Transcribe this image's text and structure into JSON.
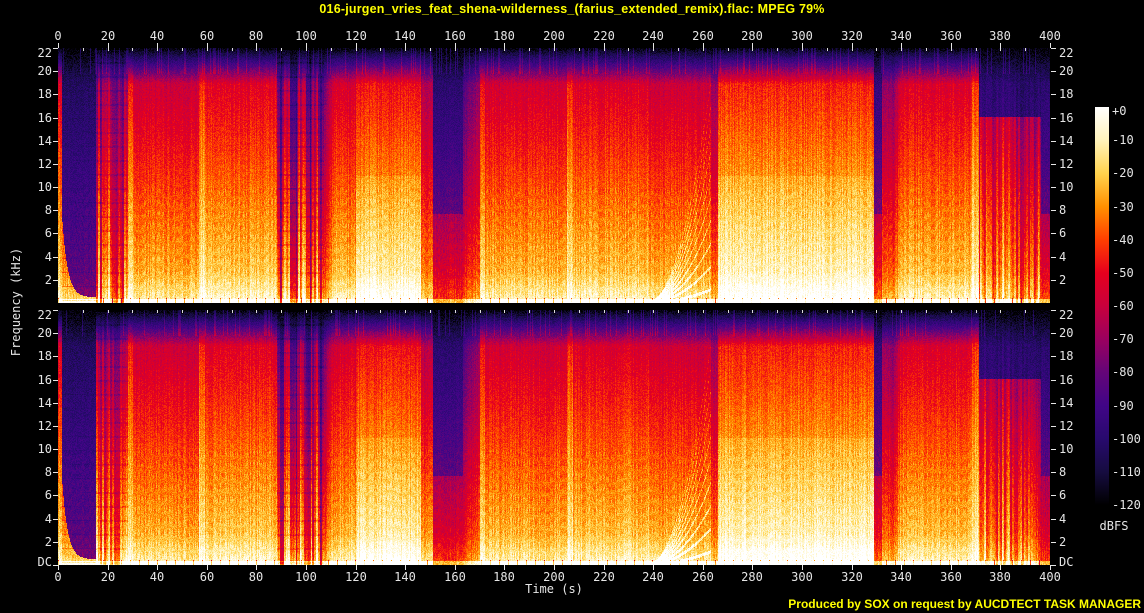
{
  "title": "016-jurgen_vries_feat_shena-wilderness_(farius_extended_remix).flac: MPEG 79%",
  "credit": "Produced by SOX on request by AUCDTECT TASK MANAGER",
  "colors": {
    "background": "#000000",
    "title_text": "#ffff00",
    "credit_text": "#ffff00",
    "axis_text": "#e6e6e6"
  },
  "chart_data": {
    "type": "heatmap",
    "subtype": "audio-spectrogram",
    "channels": [
      "left",
      "right"
    ],
    "xlabel": "Time (s)",
    "ylabel": "Frequency (kHz)",
    "x_range_s": [
      0,
      400
    ],
    "y_range_khz": [
      0,
      22
    ],
    "x_ticks": [
      0,
      20,
      40,
      60,
      80,
      100,
      120,
      140,
      160,
      180,
      200,
      220,
      240,
      260,
      280,
      300,
      320,
      340,
      360,
      380,
      400
    ],
    "x_minor_tick_step_s": 10,
    "y_ticks_khz": [
      22,
      20,
      18,
      16,
      14,
      12,
      10,
      8,
      6,
      4,
      2
    ],
    "dc_label": "DC",
    "colorbar": {
      "unit": "dBFS",
      "tick_labels": [
        "+0",
        "-10",
        "-20",
        "-30",
        "-40",
        "-50",
        "-60",
        "-70",
        "-80",
        "-90",
        "-100",
        "-110",
        "-120"
      ],
      "palette": [
        {
          "db": 0,
          "color": "#ffffff"
        },
        {
          "db": -10,
          "color": "#fff3bc"
        },
        {
          "db": -20,
          "color": "#ffd24d"
        },
        {
          "db": -30,
          "color": "#ff9000"
        },
        {
          "db": -40,
          "color": "#ff3f00"
        },
        {
          "db": -50,
          "color": "#e6001e"
        },
        {
          "db": -60,
          "color": "#c8003c"
        },
        {
          "db": -70,
          "color": "#9b005f"
        },
        {
          "db": -80,
          "color": "#640578"
        },
        {
          "db": -90,
          "color": "#410587"
        },
        {
          "db": -100,
          "color": "#280a6e"
        },
        {
          "db": -110,
          "color": "#160c40"
        },
        {
          "db": -120,
          "color": "#000000"
        }
      ]
    },
    "segments": [
      {
        "t0": 0,
        "t1": 1.6,
        "level": 0.8,
        "kind": "edge"
      },
      {
        "t0": 1.6,
        "t1": 15,
        "level": 0.33,
        "kind": "bassdecay"
      },
      {
        "t0": 15,
        "t1": 28,
        "level": 0.55,
        "kind": "stripes"
      },
      {
        "t0": 28,
        "t1": 30,
        "level": 0.9,
        "kind": "edge"
      },
      {
        "t0": 30,
        "t1": 56.5,
        "level": 0.72,
        "kind": "normal"
      },
      {
        "t0": 56.5,
        "t1": 59,
        "level": 0.92,
        "kind": "edge"
      },
      {
        "t0": 59,
        "t1": 88,
        "level": 0.8,
        "kind": "normal"
      },
      {
        "t0": 88,
        "t1": 91,
        "level": 0.38,
        "kind": "stripes"
      },
      {
        "t0": 91,
        "t1": 93.5,
        "level": 0.58,
        "kind": "stripes"
      },
      {
        "t0": 93.5,
        "t1": 96,
        "level": 0.3,
        "kind": "stripes"
      },
      {
        "t0": 96,
        "t1": 100,
        "level": 0.58,
        "kind": "stripes"
      },
      {
        "t0": 100,
        "t1": 102,
        "level": 0.3,
        "kind": "stripes"
      },
      {
        "t0": 102,
        "t1": 104.5,
        "level": 0.58,
        "kind": "stripes"
      },
      {
        "t0": 104.5,
        "t1": 107,
        "level": 0.32,
        "kind": "stripes"
      },
      {
        "t0": 107,
        "t1": 111,
        "level": 0.62,
        "kind": "ramp"
      },
      {
        "t0": 111,
        "t1": 120,
        "level": 0.76,
        "kind": "normal"
      },
      {
        "t0": 120,
        "t1": 146,
        "level": 0.82,
        "kind": "bright"
      },
      {
        "t0": 146,
        "t1": 151,
        "level": 0.64,
        "kind": "normal"
      },
      {
        "t0": 151,
        "t1": 163,
        "level": 0.3,
        "kind": "quiet"
      },
      {
        "t0": 163,
        "t1": 170,
        "level": 0.48,
        "kind": "ramp"
      },
      {
        "t0": 170,
        "t1": 172,
        "level": 0.86,
        "kind": "edge"
      },
      {
        "t0": 172,
        "t1": 205,
        "level": 0.74,
        "kind": "normal"
      },
      {
        "t0": 205,
        "t1": 207.5,
        "level": 0.9,
        "kind": "edge"
      },
      {
        "t0": 207.5,
        "t1": 238,
        "level": 0.78,
        "kind": "normal"
      },
      {
        "t0": 238,
        "t1": 263,
        "level": 0.72,
        "kind": "sweep"
      },
      {
        "t0": 263,
        "t1": 266,
        "level": 0.58,
        "kind": "normal"
      },
      {
        "t0": 266,
        "t1": 329,
        "level": 0.86,
        "kind": "bright"
      },
      {
        "t0": 329,
        "t1": 332,
        "level": 0.36,
        "kind": "quiet"
      },
      {
        "t0": 332,
        "t1": 336,
        "level": 0.55,
        "kind": "normal"
      },
      {
        "t0": 336,
        "t1": 340,
        "level": 0.65,
        "kind": "ramp"
      },
      {
        "t0": 340,
        "t1": 368.5,
        "level": 0.78,
        "kind": "normal"
      },
      {
        "t0": 368.5,
        "t1": 371,
        "level": 0.93,
        "kind": "edge"
      },
      {
        "t0": 371,
        "t1": 386,
        "level": 0.62,
        "kind": "lowpass"
      },
      {
        "t0": 386,
        "t1": 396,
        "level": 0.52,
        "kind": "lowpass"
      },
      {
        "t0": 396,
        "t1": 400,
        "level": 0.3,
        "kind": "quiet"
      }
    ]
  }
}
